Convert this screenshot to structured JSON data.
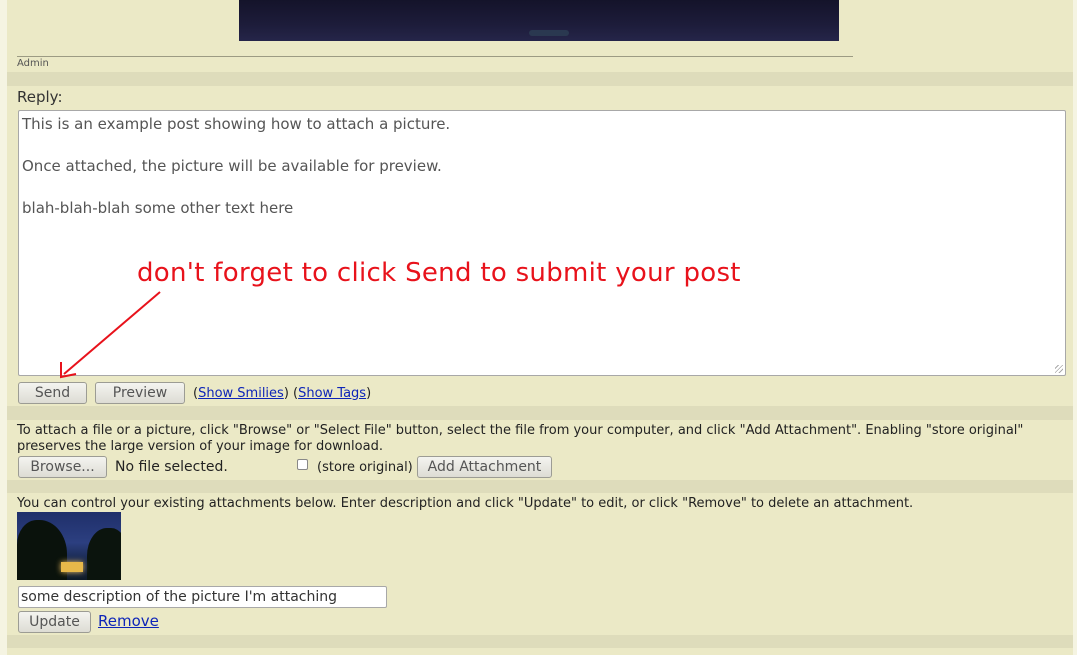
{
  "post": {
    "author": "Admin"
  },
  "reply": {
    "label": "Reply:",
    "lines": [
      "This is an example post showing how to attach a picture.",
      "Once attached, the picture will be available for preview.",
      "blah-blah-blah some other text here"
    ]
  },
  "annotation": "don't forget to click Send to submit your post",
  "buttons": {
    "send": "Send",
    "preview": "Preview"
  },
  "links": {
    "open_paren": "(",
    "show_smilies": "Show Smilies",
    "mid": ") (",
    "show_tags": "Show Tags",
    "close_paren": ")"
  },
  "attach": {
    "info": "To attach a file or a picture, click \"Browse\" or \"Select File\" button, select the file from your computer, and click \"Add Attachment\". Enabling \"store original\" preserves the large version of your image for download.",
    "browse": "Browse...",
    "file_status": "No file selected.",
    "store_original": "(store original)",
    "store_original_checked": false,
    "add_attachment": "Add Attachment"
  },
  "manage": {
    "info": "You can control your existing attachments below. Enter description and click \"Update\" to edit, or click \"Remove\" to delete an attachment.",
    "description_value": "some description of the picture I'm attaching",
    "update": "Update",
    "remove": "Remove"
  },
  "colors": {
    "background": "#ebe9c6",
    "band": "#dedcbb",
    "link": "#0d24b8",
    "annotation": "#e8121b"
  }
}
